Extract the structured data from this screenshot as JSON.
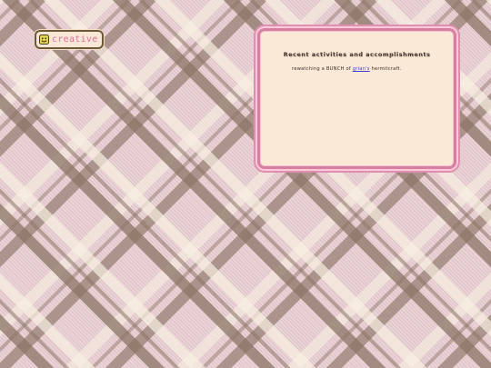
{
  "tag": {
    "label": "creative",
    "icon": "smiley-icon",
    "label_color": "#d8729a"
  },
  "panel": {
    "title": "Recent activities and accomplishments",
    "text_before": "rewatching a BUNCH of",
    "link_text": "grian's",
    "text_after": "hermitcraft.",
    "border_color": "#d77fa1",
    "background_color": "#fae9d6",
    "link_color": "#3d3bd6"
  },
  "background": {
    "pattern": "pink and brown plaid",
    "colors": [
      "#ead2d6",
      "#8b7566",
      "#f8f0e2"
    ]
  }
}
